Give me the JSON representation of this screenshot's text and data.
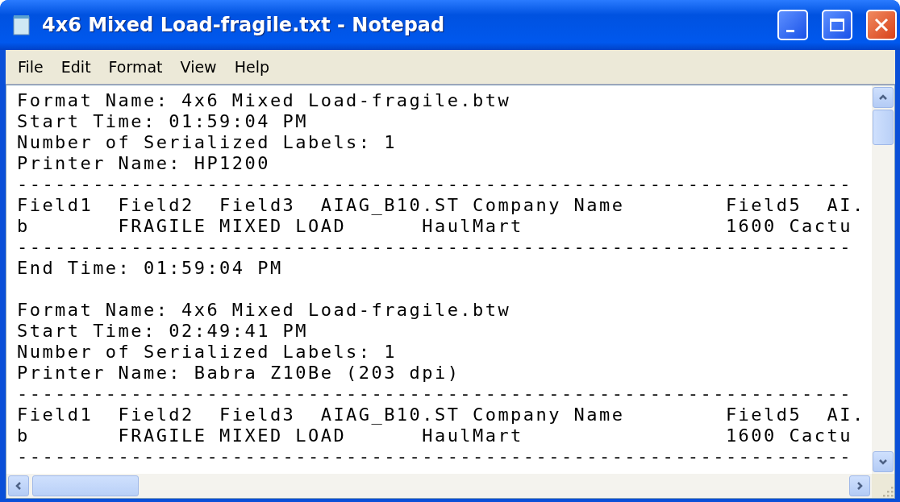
{
  "window": {
    "title": "4x6 Mixed Load-fragile.txt - Notepad"
  },
  "menu": [
    "File",
    "Edit",
    "Format",
    "View",
    "Help"
  ],
  "lines": [
    {
      "kind": "text",
      "text": "Format Name: 4x6 Mixed Load-fragile.btw"
    },
    {
      "kind": "text",
      "text": "Start Time: 01:59:04 PM"
    },
    {
      "kind": "text",
      "text": "Number of Serialized Labels: 1"
    },
    {
      "kind": "text",
      "text": "Printer Name: HP1200"
    },
    {
      "kind": "text",
      "text": "------------------------------------------------------------------"
    },
    {
      "kind": "text",
      "text": "Field1  Field2  Field3  AIAG_B10.ST Company Name        Field5  AI."
    },
    {
      "kind": "text",
      "text": "b       FRAGILE MIXED LOAD      HaulMart                1600 Cactu"
    },
    {
      "kind": "text",
      "text": "------------------------------------------------------------------"
    },
    {
      "kind": "text",
      "text": "End Time: 01:59:04 PM"
    },
    {
      "kind": "blank"
    },
    {
      "kind": "text",
      "text": "Format Name: 4x6 Mixed Load-fragile.btw"
    },
    {
      "kind": "text",
      "text": "Start Time: 02:49:41 PM"
    },
    {
      "kind": "text",
      "text": "Number of Serialized Labels: 1"
    },
    {
      "kind": "text",
      "text": "Printer Name: Babra Z10Be (203 dpi)"
    },
    {
      "kind": "text",
      "text": "------------------------------------------------------------------"
    },
    {
      "kind": "text",
      "text": "Field1  Field2  Field3  AIAG_B10.ST Company Name        Field5  AI."
    },
    {
      "kind": "text",
      "text": "b       FRAGILE MIXED LOAD      HaulMart                1600 Cactu"
    },
    {
      "kind": "text",
      "text": "------------------------------------------------------------------"
    }
  ]
}
